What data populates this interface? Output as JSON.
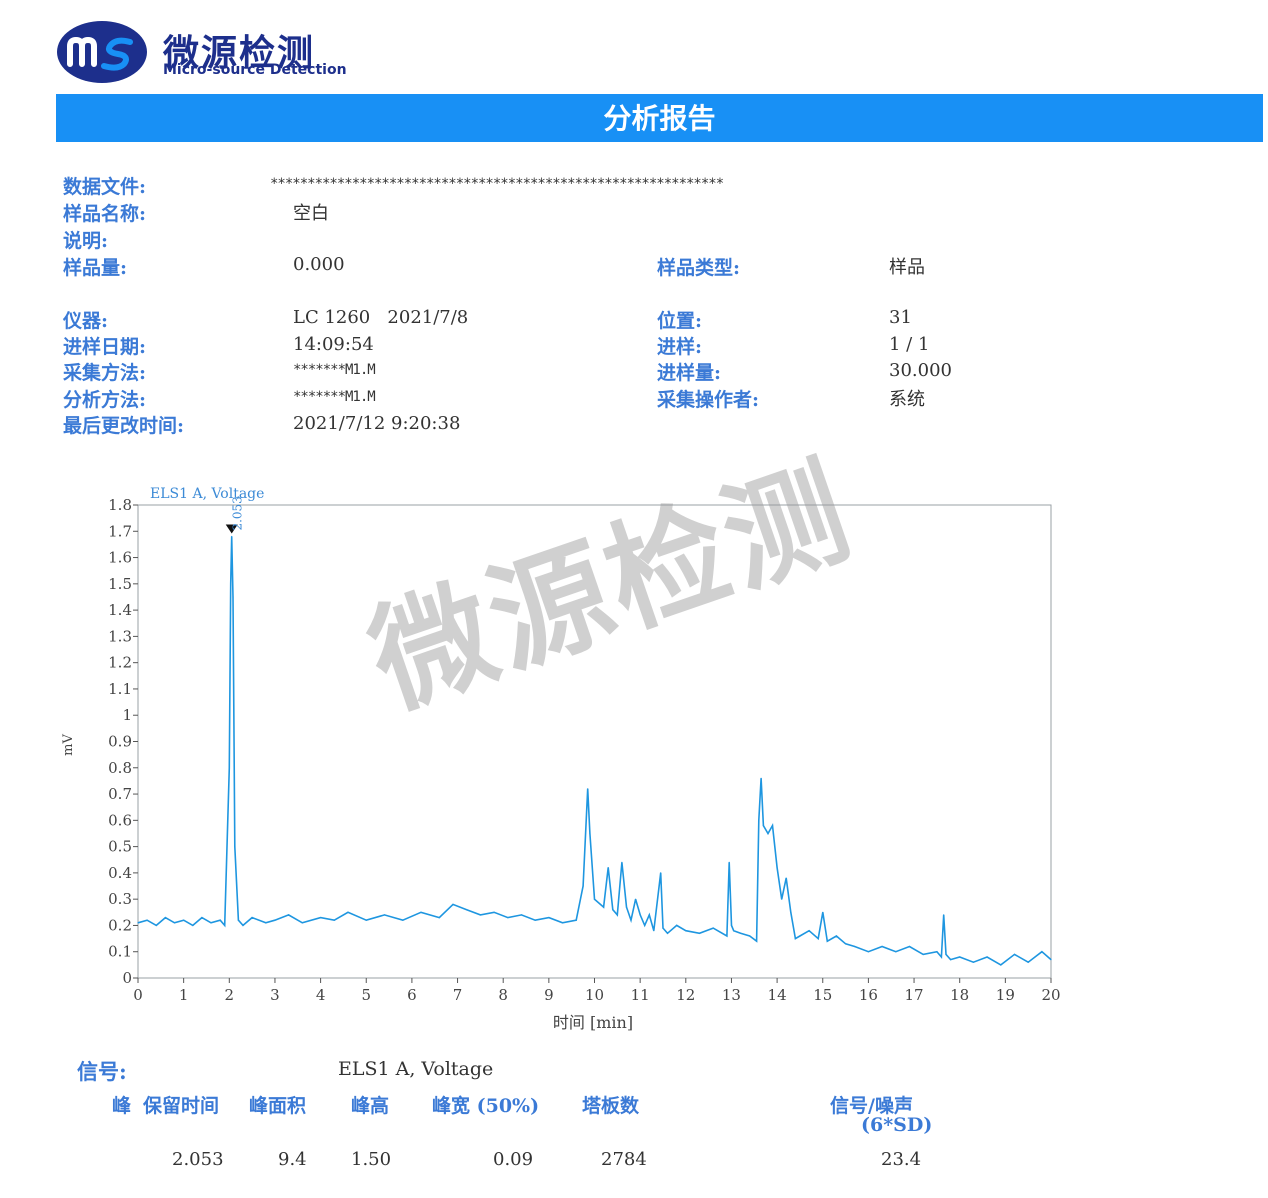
{
  "brand": {
    "logo_text": "ms",
    "name_cn": "微源检测",
    "name_en": "Micro-source Detection"
  },
  "report_title": "分析报告",
  "info": {
    "data_file_label": "数据文件:",
    "data_file_value": "*************************************************************",
    "sample_name_label": "样品名称:",
    "sample_name_value": "空白",
    "description_label": "说明:",
    "sample_amount_label": "样品量:",
    "sample_amount_value": "0.000",
    "sample_type_label": "样品类型:",
    "sample_type_value": "样品",
    "instrument_label": "仪器:",
    "instrument_value": "LC 1260   2021/7/8",
    "position_label": "位置:",
    "position_value": "31",
    "injection_date_label": "进样日期:",
    "injection_date_value": "14:09:54",
    "injection_label": "进样:",
    "injection_value": "1 / 1",
    "acq_method_label": "采集方法:",
    "acq_method_value": "*******M1.M",
    "injection_volume_label": "进样量:",
    "injection_volume_value": "30.000",
    "analysis_method_label": "分析方法:",
    "analysis_method_value": "*******M1.M",
    "operator_label": "采集操作者:",
    "operator_value": "系统",
    "last_modified_label": "最后更改时间:",
    "last_modified_value": "2021/7/12 9:20:38"
  },
  "watermark": "微源检测",
  "chart_data": {
    "type": "line",
    "title": "ELS1 A, Voltage",
    "xlabel": "时间 [min]",
    "ylabel": "mV",
    "xlim": [
      0,
      20
    ],
    "ylim": [
      0,
      1.8
    ],
    "xticks": [
      "0",
      "1",
      "2",
      "3",
      "4",
      "5",
      "6",
      "7",
      "8",
      "9",
      "10",
      "11",
      "12",
      "13",
      "14",
      "15",
      "16",
      "17",
      "18",
      "19",
      "20"
    ],
    "yticks": [
      "0",
      "0.1",
      "0.2",
      "0.3",
      "0.4",
      "0.5",
      "0.6",
      "0.7",
      "0.8",
      "0.9",
      "1",
      "1.1",
      "1.2",
      "1.3",
      "1.4",
      "1.5",
      "1.6",
      "1.7",
      "1.8"
    ],
    "peak_label": "2.053",
    "peak_marker": {
      "x": 2.053,
      "y": 1.68
    },
    "series": [
      {
        "color": "#1e96e0",
        "x": [
          0,
          0.2,
          0.4,
          0.6,
          0.8,
          1.0,
          1.2,
          1.4,
          1.6,
          1.8,
          1.9,
          2.0,
          2.03,
          2.053,
          2.08,
          2.12,
          2.2,
          2.3,
          2.5,
          2.8,
          3.0,
          3.3,
          3.6,
          4.0,
          4.3,
          4.6,
          5.0,
          5.4,
          5.8,
          6.2,
          6.6,
          6.9,
          7.2,
          7.5,
          7.8,
          8.1,
          8.4,
          8.7,
          9.0,
          9.3,
          9.6,
          9.75,
          9.85,
          9.9,
          10.0,
          10.2,
          10.3,
          10.4,
          10.5,
          10.6,
          10.7,
          10.8,
          10.9,
          11.0,
          11.1,
          11.2,
          11.3,
          11.45,
          11.5,
          11.6,
          11.8,
          12.0,
          12.3,
          12.6,
          12.9,
          12.95,
          13.0,
          13.05,
          13.2,
          13.4,
          13.55,
          13.6,
          13.65,
          13.7,
          13.8,
          13.9,
          14.0,
          14.1,
          14.2,
          14.3,
          14.4,
          14.5,
          14.7,
          14.9,
          15.0,
          15.1,
          15.3,
          15.5,
          15.7,
          16.0,
          16.3,
          16.6,
          16.9,
          17.2,
          17.5,
          17.6,
          17.65,
          17.7,
          17.8,
          18.0,
          18.3,
          18.6,
          18.9,
          19.2,
          19.5,
          19.8,
          20.0
        ],
        "values": [
          0.21,
          0.22,
          0.2,
          0.23,
          0.21,
          0.22,
          0.2,
          0.23,
          0.21,
          0.22,
          0.2,
          0.8,
          1.5,
          1.68,
          1.45,
          0.5,
          0.22,
          0.2,
          0.23,
          0.21,
          0.22,
          0.24,
          0.21,
          0.23,
          0.22,
          0.25,
          0.22,
          0.24,
          0.22,
          0.25,
          0.23,
          0.28,
          0.26,
          0.24,
          0.25,
          0.23,
          0.24,
          0.22,
          0.23,
          0.21,
          0.22,
          0.35,
          0.72,
          0.55,
          0.3,
          0.27,
          0.42,
          0.26,
          0.24,
          0.44,
          0.27,
          0.22,
          0.3,
          0.24,
          0.2,
          0.24,
          0.18,
          0.4,
          0.19,
          0.17,
          0.2,
          0.18,
          0.17,
          0.19,
          0.16,
          0.44,
          0.2,
          0.18,
          0.17,
          0.16,
          0.14,
          0.6,
          0.76,
          0.58,
          0.55,
          0.58,
          0.42,
          0.3,
          0.38,
          0.25,
          0.15,
          0.16,
          0.18,
          0.15,
          0.25,
          0.14,
          0.16,
          0.13,
          0.12,
          0.1,
          0.12,
          0.1,
          0.12,
          0.09,
          0.1,
          0.08,
          0.24,
          0.09,
          0.07,
          0.08,
          0.06,
          0.08,
          0.05,
          0.09,
          0.06,
          0.1,
          0.07
        ]
      }
    ]
  },
  "results": {
    "signal_label": "信号:",
    "signal_value": "ELS1 A, Voltage",
    "headers": {
      "peak": "峰",
      "retention_time": "保留时间",
      "peak_area": "峰面积",
      "peak_height": "峰高",
      "peak_width": "峰宽 (50%)",
      "plates": "塔板数",
      "signal_noise": "信号/噪声",
      "signal_noise_sub": "(6*SD)"
    },
    "row": {
      "retention_time": "2.053",
      "peak_area": "9.4",
      "peak_height": "1.50",
      "peak_width": "0.09",
      "plates": "2784",
      "signal_noise": "23.4"
    }
  }
}
